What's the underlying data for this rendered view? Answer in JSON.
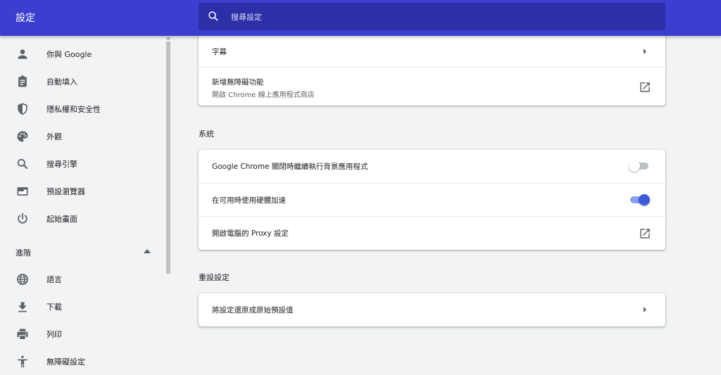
{
  "header": {
    "title": "設定",
    "search_placeholder": "搜尋設定"
  },
  "sidebar": {
    "items": [
      {
        "label": "你與 Google",
        "icon": "person-icon"
      },
      {
        "label": "自動填入",
        "icon": "clipboard-icon"
      },
      {
        "label": "隱私權和安全性",
        "icon": "shield-icon"
      },
      {
        "label": "外觀",
        "icon": "palette-icon"
      },
      {
        "label": "搜尋引擎",
        "icon": "search-icon"
      },
      {
        "label": "預設瀏覽器",
        "icon": "browser-icon"
      },
      {
        "label": "起始畫面",
        "icon": "power-icon"
      }
    ],
    "advanced_label": "進階",
    "advanced_items": [
      {
        "label": "語言",
        "icon": "globe-icon"
      },
      {
        "label": "下載",
        "icon": "download-icon"
      },
      {
        "label": "列印",
        "icon": "printer-icon"
      },
      {
        "label": "無障礙設定",
        "icon": "accessibility-icon"
      }
    ]
  },
  "accessibility_card": {
    "captions_label": "字幕",
    "add_features_label": "新增無障礙功能",
    "add_features_sub": "開啟 Chrome 線上應用程式商店"
  },
  "system": {
    "title": "系統",
    "background_apps_label": "Google Chrome 關閉時繼續執行背景應用程式",
    "background_apps_on": false,
    "hardware_accel_label": "在可用時使用硬體加速",
    "hardware_accel_on": true,
    "proxy_label": "開啟電腦的 Proxy 設定"
  },
  "reset": {
    "title": "重設設定",
    "restore_label": "將設定還原成原始預設值"
  },
  "colors": {
    "header_bg": "#3b3fd0",
    "search_bg": "#2c2fa6",
    "accent": "#3b5bdb",
    "page_bg": "#f1f3f4"
  }
}
